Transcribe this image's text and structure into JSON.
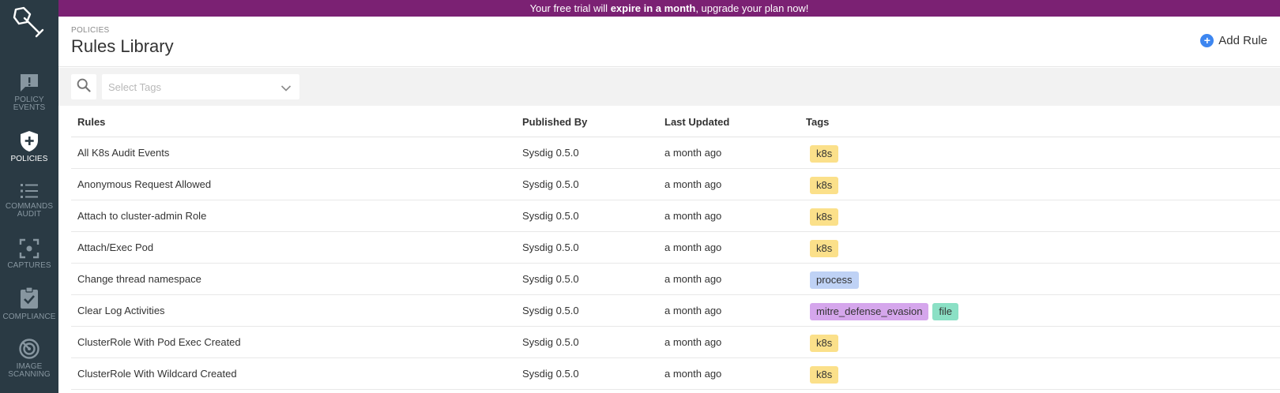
{
  "colors": {
    "sidebar_bg": "#2a3a44",
    "banner_bg": "#7b2173",
    "accent_blue": "#3d86f0",
    "tag_k8s": "#fbe08a",
    "tag_process": "#bfd2f5",
    "tag_mitre": "#d5a6ec",
    "tag_file": "#8be0c5"
  },
  "sidebar": {
    "logo_icon": "shovel-logo-icon",
    "items": [
      {
        "label": "POLICY\nEVENTS",
        "icon": "alert-message-icon",
        "active": false
      },
      {
        "label": "POLICIES",
        "icon": "shield-plus-icon",
        "active": true
      },
      {
        "label": "COMMANDS\nAUDIT",
        "icon": "list-icon",
        "active": false
      },
      {
        "label": "CAPTURES",
        "icon": "capture-icon",
        "active": false
      },
      {
        "label": "COMPLIANCE",
        "icon": "clipboard-check-icon",
        "active": false
      },
      {
        "label": "IMAGE\nSCANNING",
        "icon": "radar-icon",
        "active": false
      }
    ]
  },
  "banner": {
    "prefix": "Your free trial will ",
    "emphasis": "expire in a month",
    "suffix": ", upgrade your plan now!"
  },
  "header": {
    "breadcrumb": "POLICIES",
    "title": "Rules Library",
    "add_rule_label": "Add Rule"
  },
  "filter": {
    "search_icon": "search-icon",
    "tags_placeholder": "Select Tags"
  },
  "table": {
    "columns": [
      "Rules",
      "Published By",
      "Last Updated",
      "Tags"
    ],
    "rows": [
      {
        "rule": "All K8s Audit Events",
        "published_by": "Sysdig 0.5.0",
        "last_updated": "a month ago",
        "tags": [
          "k8s"
        ]
      },
      {
        "rule": "Anonymous Request Allowed",
        "published_by": "Sysdig 0.5.0",
        "last_updated": "a month ago",
        "tags": [
          "k8s"
        ]
      },
      {
        "rule": "Attach to cluster-admin Role",
        "published_by": "Sysdig 0.5.0",
        "last_updated": "a month ago",
        "tags": [
          "k8s"
        ]
      },
      {
        "rule": "Attach/Exec Pod",
        "published_by": "Sysdig 0.5.0",
        "last_updated": "a month ago",
        "tags": [
          "k8s"
        ]
      },
      {
        "rule": "Change thread namespace",
        "published_by": "Sysdig 0.5.0",
        "last_updated": "a month ago",
        "tags": [
          "process"
        ]
      },
      {
        "rule": "Clear Log Activities",
        "published_by": "Sysdig 0.5.0",
        "last_updated": "a month ago",
        "tags": [
          "mitre_defense_evasion",
          "file"
        ]
      },
      {
        "rule": "ClusterRole With Pod Exec Created",
        "published_by": "Sysdig 0.5.0",
        "last_updated": "a month ago",
        "tags": [
          "k8s"
        ]
      },
      {
        "rule": "ClusterRole With Wildcard Created",
        "published_by": "Sysdig 0.5.0",
        "last_updated": "a month ago",
        "tags": [
          "k8s"
        ]
      }
    ]
  }
}
